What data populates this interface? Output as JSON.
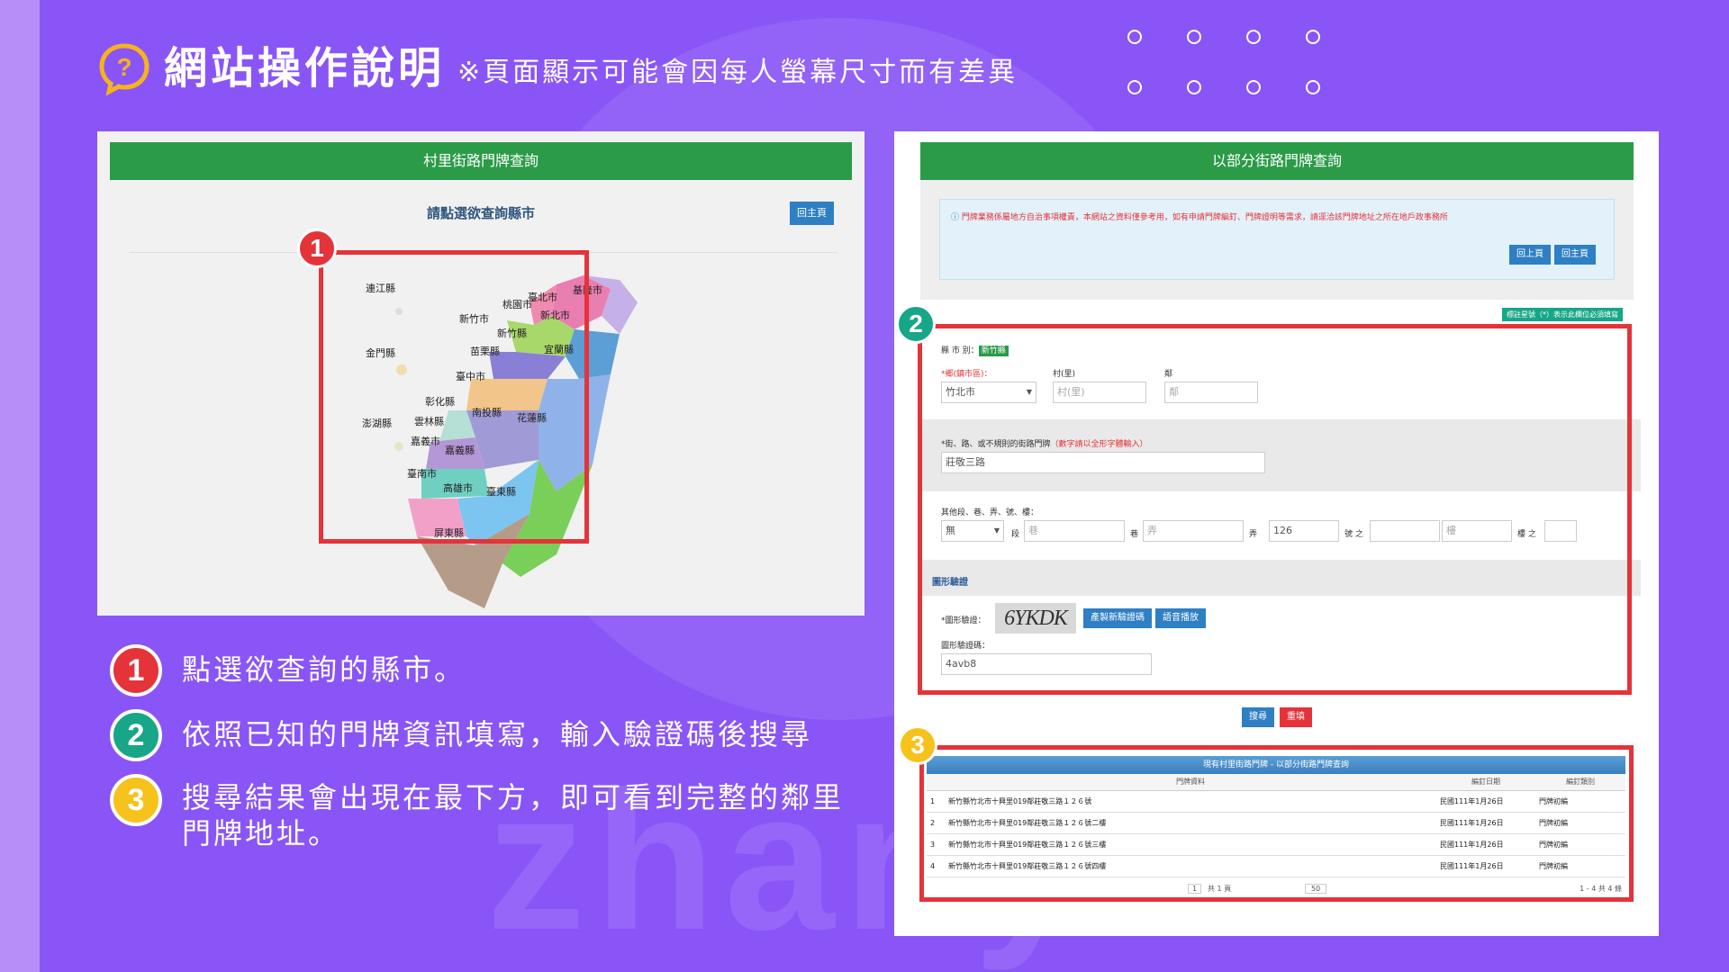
{
  "header": {
    "title": "網站操作說明",
    "subtitle": "※頁面顯示可能會因每人螢幕尺寸而有差異"
  },
  "left_panel": {
    "title": "村里街路門牌查詢",
    "prompt": "請點選欲查詢縣市",
    "home_button": "回主頁",
    "map_labels": [
      "連江縣",
      "金門縣",
      "澎湖縣",
      "基隆市",
      "臺北市",
      "新北市",
      "桃園市",
      "新竹市",
      "新竹縣",
      "宜蘭縣",
      "苗栗縣",
      "臺中市",
      "彰化縣",
      "南投縣",
      "花蓮縣",
      "雲林縣",
      "嘉義市",
      "嘉義縣",
      "臺南市",
      "高雄市",
      "臺東縣",
      "屏東縣"
    ]
  },
  "right_panel": {
    "title": "以部分街路門牌查詢",
    "notice": "門牌業務係屬地方自治事項權責，本網站之資料僅參考用，如有申請門牌編釘、門牌證明等需求，請逕洽該門牌地址之所在地戶政事務所",
    "prev_button": "回上頁",
    "home_button": "回主頁",
    "required_note": "標註星號（*）表示此欄位必須填寫",
    "county_label": "縣 市 別：",
    "county_value": "新竹縣",
    "township_label": "*鄉(鎮市區)：",
    "township_value": "竹北市",
    "village_label": "村(里)",
    "village_placeholder": "村(里)",
    "neighbor_label": "鄰",
    "neighbor_placeholder": "鄰",
    "street_label": "*街、路、或不規則的街路門牌",
    "street_hint": "（數字請以全形字體輸入）",
    "street_value": "莊敬三路",
    "other_label": "其他段、巷、弄、號、樓：",
    "section_select": "無",
    "section_unit": "段",
    "lane_placeholder": "巷",
    "lane_unit": "巷",
    "alley_placeholder": "弄",
    "alley_unit": "弄",
    "number_value": "126",
    "number_unit": "號 之",
    "floor_placeholder": "樓",
    "floor_unit": "樓 之",
    "captcha_section": "圖形驗證",
    "captcha_label": "*圖形驗證：",
    "captcha_image_text": "6YKDK",
    "refresh_button": "產製新驗證碼",
    "audio_button": "語音播放",
    "captcha_input_label": "圖形驗證碼：",
    "captcha_input_value": "4avb8",
    "search_button": "搜尋",
    "reset_button": "重填"
  },
  "results": {
    "header": "現有村里街路門牌 - 以部分街路門牌查詢",
    "columns": [
      "",
      "門牌資料",
      "編釘日期",
      "編釘類別"
    ],
    "rows": [
      [
        "1",
        "新竹縣竹北市十興里019鄰莊敬三路１２６號",
        "民國111年1月26日",
        "門牌初編"
      ],
      [
        "2",
        "新竹縣竹北市十興里019鄰莊敬三路１２６號二樓",
        "民國111年1月26日",
        "門牌初編"
      ],
      [
        "3",
        "新竹縣竹北市十興里019鄰莊敬三路１２６號三樓",
        "民國111年1月26日",
        "門牌初編"
      ],
      [
        "4",
        "新竹縣竹北市十興里019鄰莊敬三路１２６號四樓",
        "民國111年1月26日",
        "門牌初編"
      ]
    ],
    "pager_page": "1",
    "pager_total": "共 1 頁",
    "pager_size": "50",
    "pager_range": "1 - 4 共 4 條"
  },
  "badges": [
    "1",
    "2",
    "3"
  ],
  "steps": [
    {
      "num": "1",
      "text": "點選欲查詢的縣市。"
    },
    {
      "num": "2",
      "text": "依照已知的門牌資訊填寫，輸入驗證碼後搜尋"
    },
    {
      "num": "3",
      "text": "搜尋結果會出現在最下方，即可看到完整的鄰里門牌地址。"
    }
  ],
  "watermark": "zhanyi",
  "colors": {
    "background": "#8a55f6",
    "green": "#2b9b48",
    "red": "#e5333a",
    "teal": "#17a687",
    "yellow": "#f6c21c",
    "blue_button": "#2e7fc4"
  }
}
